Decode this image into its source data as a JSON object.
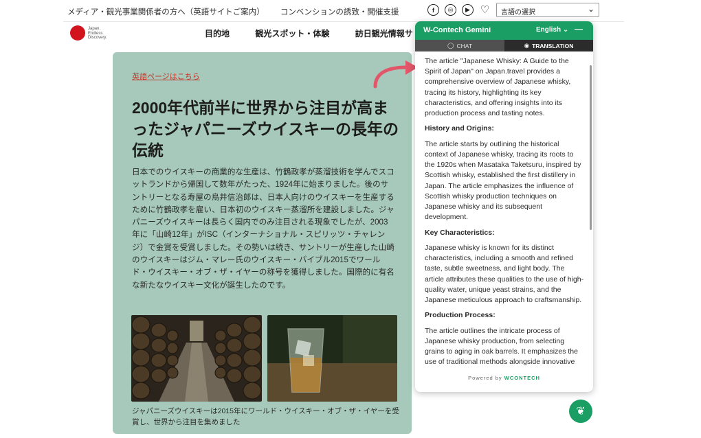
{
  "topbar": {
    "links": [
      "メディア・観光事業関係者の方へ（英語サイトご案内）",
      "コンベンションの誘致・開催支援"
    ],
    "social_icons": [
      "facebook-icon",
      "instagram-icon",
      "youtube-icon",
      "heart-icon"
    ],
    "language_select": "言語の選択"
  },
  "nav": {
    "logo_text": "Japan. Endless Discovery.",
    "items": [
      "目的地",
      "観光スポット・体験",
      "訪日観光情報サ"
    ]
  },
  "article": {
    "english_link": "英語ページはこちら",
    "headline": "2000年代前半に世界から注目が高まったジャパニーズウイスキーの長年の伝統",
    "body": "日本でのウイスキーの商業的な生産は、竹鶴政孝が蒸溜技術を学んでスコットランドから帰国して数年がたった、1924年に始まりました。後のサントリーとなる寿屋の鳥井信治郎は、日本人向けのウイスキーを生産するために竹鶴政孝を雇い、日本初のウイスキー蒸溜所を建設しました。ジャパニーズウイスキーは長らく国内でのみ注目される現象でしたが、2003年に「山崎12年」がISC（インターナショナル・スピリッツ・チャレンジ）で金賞を受賞しました。その勢いは続き、サントリーが生産した山崎のウイスキーはジム・マレー氏のウイスキー・バイブル2015でワールド・ウイスキー・オブ・ザ・イヤーの称号を獲得しました。国際的に有名な新たなウイスキー文化が誕生したのです。",
    "caption": "ジャパニーズウイスキーは2015年にワールド・ウイスキー・オブ・ザ・イヤーを受賞し、世界から注目を集めました"
  },
  "panel": {
    "title": "W-Contech Gemini",
    "language": "English",
    "tabs": {
      "chat": "CHAT",
      "translation": "TRANSLATION"
    },
    "paragraphs": [
      {
        "type": "text",
        "text": "The article \"Japanese Whisky: A Guide to the Spirit of Japan\" on Japan.travel provides a comprehensive overview of Japanese whisky, tracing its history, highlighting its key characteristics, and offering insights into its production process and tasting notes."
      },
      {
        "type": "heading",
        "text": "History and Origins:"
      },
      {
        "type": "text",
        "text": "The article starts by outlining the historical context of Japanese whisky, tracing its roots to the 1920s when Masataka Taketsuru, inspired by Scottish whisky, established the first distillery in Japan. The article emphasizes the influence of Scottish whisky production techniques on Japanese whisky and its subsequent development."
      },
      {
        "type": "heading",
        "text": "Key Characteristics:"
      },
      {
        "type": "text",
        "text": "Japanese whisky is known for its distinct characteristics, including a smooth and refined taste, subtle sweetness, and light body. The article attributes these qualities to the use of high-quality water, unique yeast strains, and the Japanese meticulous approach to craftsmanship."
      },
      {
        "type": "heading",
        "text": "Production Process:"
      },
      {
        "type": "text",
        "text": "The article outlines the intricate process of Japanese whisky production, from selecting grains to aging in oak barrels. It emphasizes the use of traditional methods alongside innovative"
      }
    ],
    "footer_prefix": "Powered by",
    "footer_brand": "WCONTECH"
  },
  "colors": {
    "accent_green": "#1a9e63",
    "article_bg": "#a6c9bb",
    "arrow": "#e2566a",
    "logo_red": "#d2141e"
  }
}
